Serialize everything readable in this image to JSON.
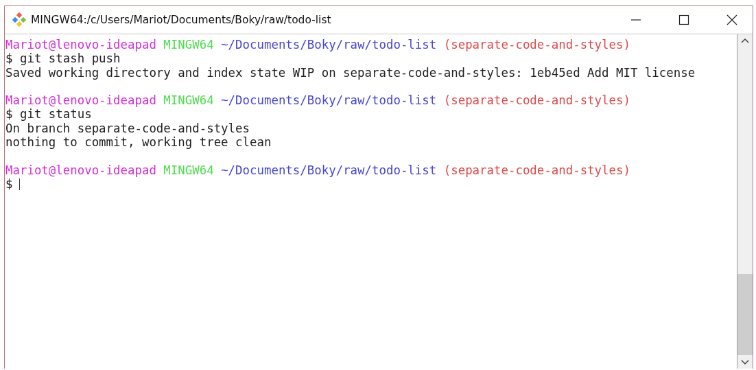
{
  "window": {
    "title": "MINGW64:/c/Users/Mariot/Documents/Boky/raw/todo-list"
  },
  "terminal": {
    "lines": [
      {
        "kind": "prompt",
        "segments": [
          {
            "text": "Mariot@lenovo-ideapad",
            "color": "#d52fd5"
          },
          {
            "text": "MINGW64",
            "color": "#4fdc4f"
          },
          {
            "text": "~/Documents/Boky/raw/todo-list",
            "color": "#4646d6"
          },
          {
            "text": "(separate-code-and-styles)",
            "color": "#e04848"
          }
        ]
      },
      {
        "kind": "output",
        "text": "$ git stash push"
      },
      {
        "kind": "output",
        "text": "Saved working directory and index state WIP on separate-code-and-styles: 1eb45ed Add MIT license"
      },
      {
        "kind": "blank"
      },
      {
        "kind": "prompt",
        "segments": [
          {
            "text": "Mariot@lenovo-ideapad",
            "color": "#d52fd5"
          },
          {
            "text": "MINGW64",
            "color": "#4fdc4f"
          },
          {
            "text": "~/Documents/Boky/raw/todo-list",
            "color": "#4646d6"
          },
          {
            "text": "(separate-code-and-styles)",
            "color": "#e04848"
          }
        ]
      },
      {
        "kind": "output",
        "text": "$ git status"
      },
      {
        "kind": "output",
        "text": "On branch separate-code-and-styles"
      },
      {
        "kind": "output",
        "text": "nothing to commit, working tree clean"
      },
      {
        "kind": "blank"
      },
      {
        "kind": "prompt",
        "segments": [
          {
            "text": "Mariot@lenovo-ideapad",
            "color": "#d52fd5"
          },
          {
            "text": "MINGW64",
            "color": "#4fdc4f"
          },
          {
            "text": "~/Documents/Boky/raw/todo-list",
            "color": "#4646d6"
          },
          {
            "text": "(separate-code-and-styles)",
            "color": "#e04848"
          }
        ]
      },
      {
        "kind": "input",
        "text": "$"
      }
    ]
  }
}
